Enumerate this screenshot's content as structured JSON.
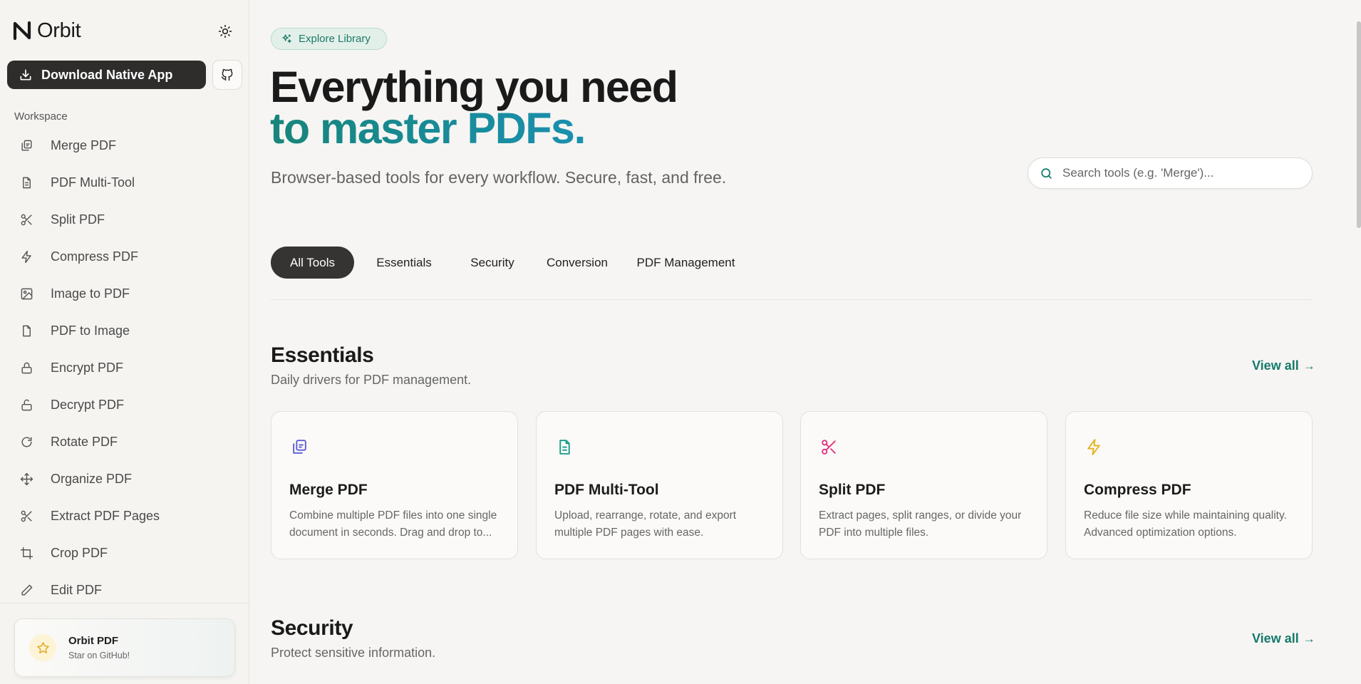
{
  "sidebar": {
    "brand": "Orbit",
    "download_label": "Download Native App",
    "section_label": "Workspace",
    "items": [
      {
        "label": "Merge PDF",
        "icon": "merge-icon"
      },
      {
        "label": "PDF Multi-Tool",
        "icon": "document-icon"
      },
      {
        "label": "Split PDF",
        "icon": "scissors-icon"
      },
      {
        "label": "Compress PDF",
        "icon": "lightning-icon"
      },
      {
        "label": "Image to PDF",
        "icon": "image-icon"
      },
      {
        "label": "PDF to Image",
        "icon": "file-icon"
      },
      {
        "label": "Encrypt PDF",
        "icon": "lock-icon"
      },
      {
        "label": "Decrypt PDF",
        "icon": "unlock-icon"
      },
      {
        "label": "Rotate PDF",
        "icon": "rotate-icon"
      },
      {
        "label": "Organize PDF",
        "icon": "move-icon"
      },
      {
        "label": "Extract PDF Pages",
        "icon": "scissors-icon"
      },
      {
        "label": "Crop PDF",
        "icon": "crop-icon"
      },
      {
        "label": "Edit PDF",
        "icon": "pen-icon"
      }
    ],
    "promo": {
      "title": "Orbit PDF",
      "subtitle": "Star on GitHub!"
    }
  },
  "main": {
    "pill_label": "Explore Library",
    "hero_line1": "Everything you need",
    "hero_line2": "to master PDFs.",
    "subtitle": "Browser-based tools for every workflow. Secure, fast, and free.",
    "search_placeholder": "Search tools (e.g. 'Merge')...",
    "tabs": [
      {
        "label": "All Tools",
        "active": true
      },
      {
        "label": "Essentials",
        "active": false
      },
      {
        "label": "Security",
        "active": false
      },
      {
        "label": "Conversion",
        "active": false
      },
      {
        "label": "PDF Management",
        "active": false
      }
    ],
    "essentials": {
      "title": "Essentials",
      "subtitle": "Daily drivers for PDF management.",
      "view_all": "View all",
      "cards": [
        {
          "title": "Merge PDF",
          "desc": "Combine multiple PDF files into one single document in seconds. Drag and drop to...",
          "icon": "merge-icon",
          "color": "#5b5bd6"
        },
        {
          "title": "PDF Multi-Tool",
          "desc": "Upload, rearrange, rotate, and export multiple PDF pages with ease.",
          "icon": "document-icon",
          "color": "#129a8a"
        },
        {
          "title": "Split PDF",
          "desc": "Extract pages, split ranges, or divide your PDF into multiple files.",
          "icon": "scissors-icon",
          "color": "#e0357f"
        },
        {
          "title": "Compress PDF",
          "desc": "Reduce file size while maintaining quality. Advanced optimization options.",
          "icon": "lightning-icon",
          "color": "#e6b21a"
        }
      ]
    },
    "security": {
      "title": "Security",
      "subtitle": "Protect sensitive information.",
      "view_all": "View all"
    }
  },
  "colors": {
    "accent": "#167a6b",
    "dark": "#2e2d2c",
    "hero_gradient": [
      "#17857a",
      "#1a90b0"
    ]
  }
}
